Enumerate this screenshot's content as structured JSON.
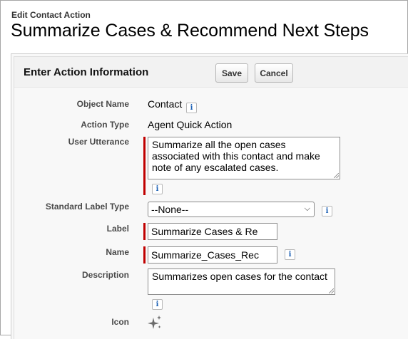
{
  "header": {
    "breadcrumb": "Edit Contact Action",
    "title": "Summarize Cases & Recommend Next Steps"
  },
  "section": {
    "title": "Enter Action Information",
    "save_label": "Save",
    "cancel_label": "Cancel"
  },
  "fields": {
    "object_name": {
      "label": "Object Name",
      "value": "Contact"
    },
    "action_type": {
      "label": "Action Type",
      "value": "Agent Quick Action"
    },
    "user_utterance": {
      "label": "User Utterance",
      "value": "Summarize all the open cases associated with this contact and make note of any escalated cases."
    },
    "standard_label_type": {
      "label": "Standard Label Type",
      "value": "--None--"
    },
    "label": {
      "label": "Label",
      "value": "Summarize Cases & Re"
    },
    "name": {
      "label": "Name",
      "value": "Summarize_Cases_Rec"
    },
    "description": {
      "label": "Description",
      "value": "Summarizes open cases for the contact"
    },
    "icon": {
      "label": "Icon",
      "icon_name": "sparkle-icon"
    }
  },
  "info_glyph": "i",
  "colors": {
    "required": "#c00000",
    "info": "#1a5fb4"
  }
}
